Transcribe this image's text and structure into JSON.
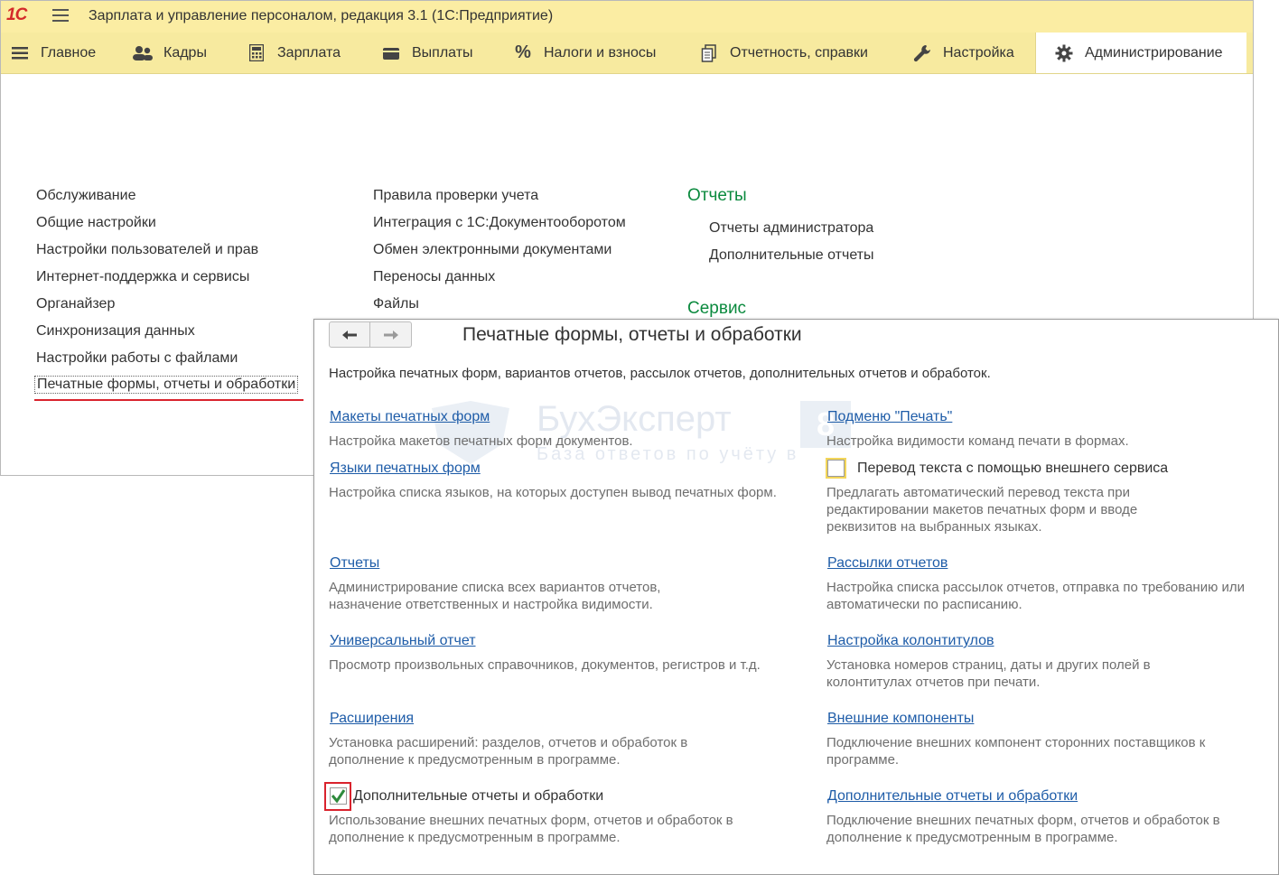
{
  "app": {
    "logo": "1С",
    "title": "Зарплата и управление персоналом, редакция 3.1  (1С:Предприятие)"
  },
  "sections": [
    {
      "label": "Главное",
      "icon": "menu-lines-icon"
    },
    {
      "label": "Кадры",
      "icon": "people-icon"
    },
    {
      "label": "Зарплата",
      "icon": "calculator-icon"
    },
    {
      "label": "Выплаты",
      "icon": "wallet-icon"
    },
    {
      "label": "Налоги и взносы",
      "icon": "percent-icon"
    },
    {
      "label": "Отчетность, справки",
      "icon": "documents-icon"
    },
    {
      "label": "Настройка",
      "icon": "wrench-icon"
    },
    {
      "label": "Администрирование",
      "icon": "gear-icon",
      "active": true
    }
  ],
  "panel": {
    "col1": [
      "Обслуживание",
      "Общие настройки",
      "Настройки пользователей и прав",
      "Интернет-поддержка и сервисы",
      "Органайзер",
      "Синхронизация данных",
      "Настройки работы с файлами",
      "Печатные формы, отчеты и обработки"
    ],
    "col2": [
      "Правила проверки учета",
      "Интеграция с 1С:Документооборотом",
      "Обмен электронными документами",
      "Переносы данных",
      "Файлы"
    ],
    "reports_heading": "Отчеты",
    "reports_items": [
      "Отчеты администратора",
      "Дополнительные отчеты"
    ],
    "service_heading": "Сервис"
  },
  "popup": {
    "title": "Печатные формы, отчеты и обработки",
    "description": "Настройка печатных форм, вариантов отчетов, рассылок отчетов, дополнительных отчетов и обработок.",
    "watermark": {
      "title": "БухЭксперт",
      "subtitle": "База ответов по учёту в",
      "badge": "8"
    },
    "left": [
      {
        "link": "Макеты печатных форм",
        "desc": "Настройка макетов печатных форм документов."
      },
      {
        "link": "Языки печатных форм",
        "desc": "Настройка списка языков, на которых доступен вывод печатных форм."
      },
      {
        "link": "Отчеты",
        "desc": "Администрирование списка всех вариантов отчетов, назначение ответственных и настройка видимости."
      },
      {
        "link": "Универсальный отчет",
        "desc": "Просмотр произвольных справочников, документов, регистров и т.д."
      },
      {
        "link": "Расширения",
        "desc": "Установка расширений: разделов, отчетов и обработок в дополнение к предусмотренным в программе."
      },
      {
        "checkbox": "Дополнительные отчеты и обработки",
        "checked": true,
        "desc": "Использование внешних печатных форм, отчетов и обработок в дополнение к предусмотренным в программе."
      }
    ],
    "right": [
      {
        "link": "Подменю \"Печать\"",
        "desc": "Настройка видимости команд печати в формах."
      },
      {
        "checkbox": "Перевод текста с помощью внешнего сервиса",
        "checked": false,
        "desc": "Предлагать автоматический перевод текста при редактировании макетов печатных форм и вводе реквизитов на выбранных языках."
      },
      {
        "link": "Рассылки отчетов",
        "desc": "Настройка списка рассылок отчетов, отправка по требованию или автоматически по расписанию."
      },
      {
        "link": "Настройка колонтитулов",
        "desc": "Установка номеров страниц, даты и других полей в колонтитулах отчетов при печати."
      },
      {
        "link": "Внешние компоненты",
        "desc": "Подключение внешних компонент сторонних поставщиков к программе."
      },
      {
        "link": "Дополнительные отчеты и обработки",
        "desc": "Подключение внешних печатных форм, отчетов и обработок в дополнение к предусмотренным в программе."
      }
    ]
  },
  "colors": {
    "titlebar": "#fbeda3",
    "sectionbar": "#f7ea9f",
    "link": "#1e5ca8",
    "heading_green": "#0b8a3e",
    "highlight_red": "#d9232d"
  }
}
